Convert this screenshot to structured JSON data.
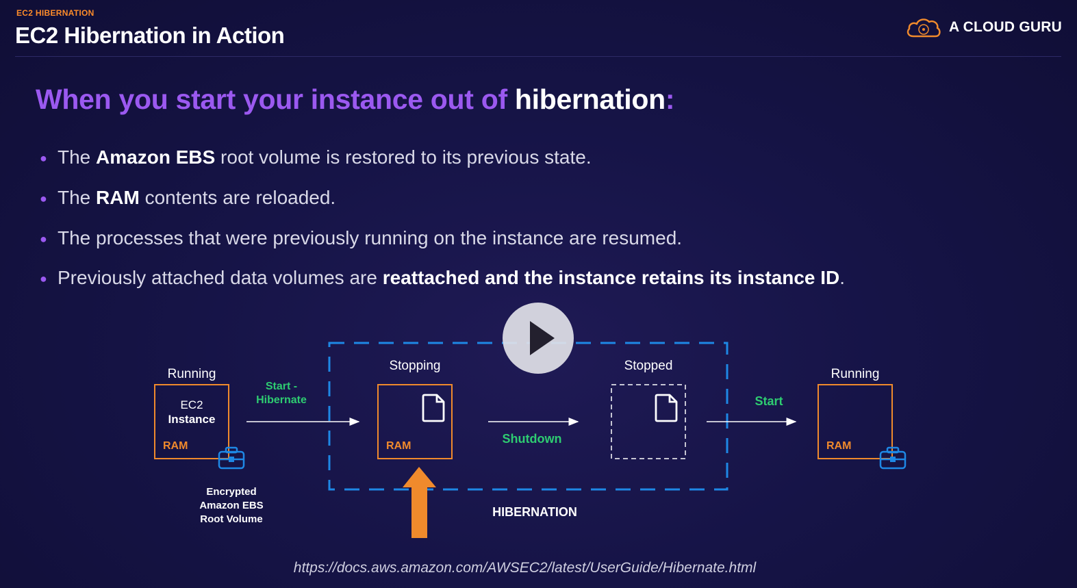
{
  "header": {
    "kicker": "EC2 HIBERNATION",
    "title": "EC2 Hibernation in Action",
    "brand": "A CLOUD GURU"
  },
  "heading": {
    "part1": "When you start your instance out of",
    "part2": "hibernation",
    "part3": ":"
  },
  "bullets": [
    {
      "pre": "The ",
      "bold": "Amazon EBS",
      "post": " root volume is restored to its previous state."
    },
    {
      "pre": "The ",
      "bold": "RAM",
      "post": " contents are reloaded."
    },
    {
      "pre": "The processes that were previously running on the instance are resumed.",
      "bold": "",
      "post": ""
    },
    {
      "pre": "Previously attached data volumes are ",
      "bold": "reattached and the instance retains its instance ID",
      "post": "."
    }
  ],
  "diagram": {
    "running_left_label": "Running",
    "ec2_line1": "EC2",
    "ec2_line2": "Instance",
    "ram": "RAM",
    "start_hibernate_line1": "Start -",
    "start_hibernate_line2": "Hibernate",
    "stopping_label": "Stopping",
    "shutdown_label": "Shutdown",
    "stopped_label": "Stopped",
    "start_label": "Start",
    "running_right_label": "Running",
    "ebs_line1": "Encrypted",
    "ebs_line2": "Amazon EBS",
    "ebs_line3": "Root Volume",
    "hibernation_label": "HIBERNATION"
  },
  "colors": {
    "purple": "#9b59f0",
    "orange": "#f08a2c",
    "green": "#2ecc71",
    "blue": "#1e88e5"
  },
  "doc_link": "https://docs.aws.amazon.com/AWSEC2/latest/UserGuide/Hibernate.html",
  "video": {
    "play_icon": "play-icon"
  }
}
